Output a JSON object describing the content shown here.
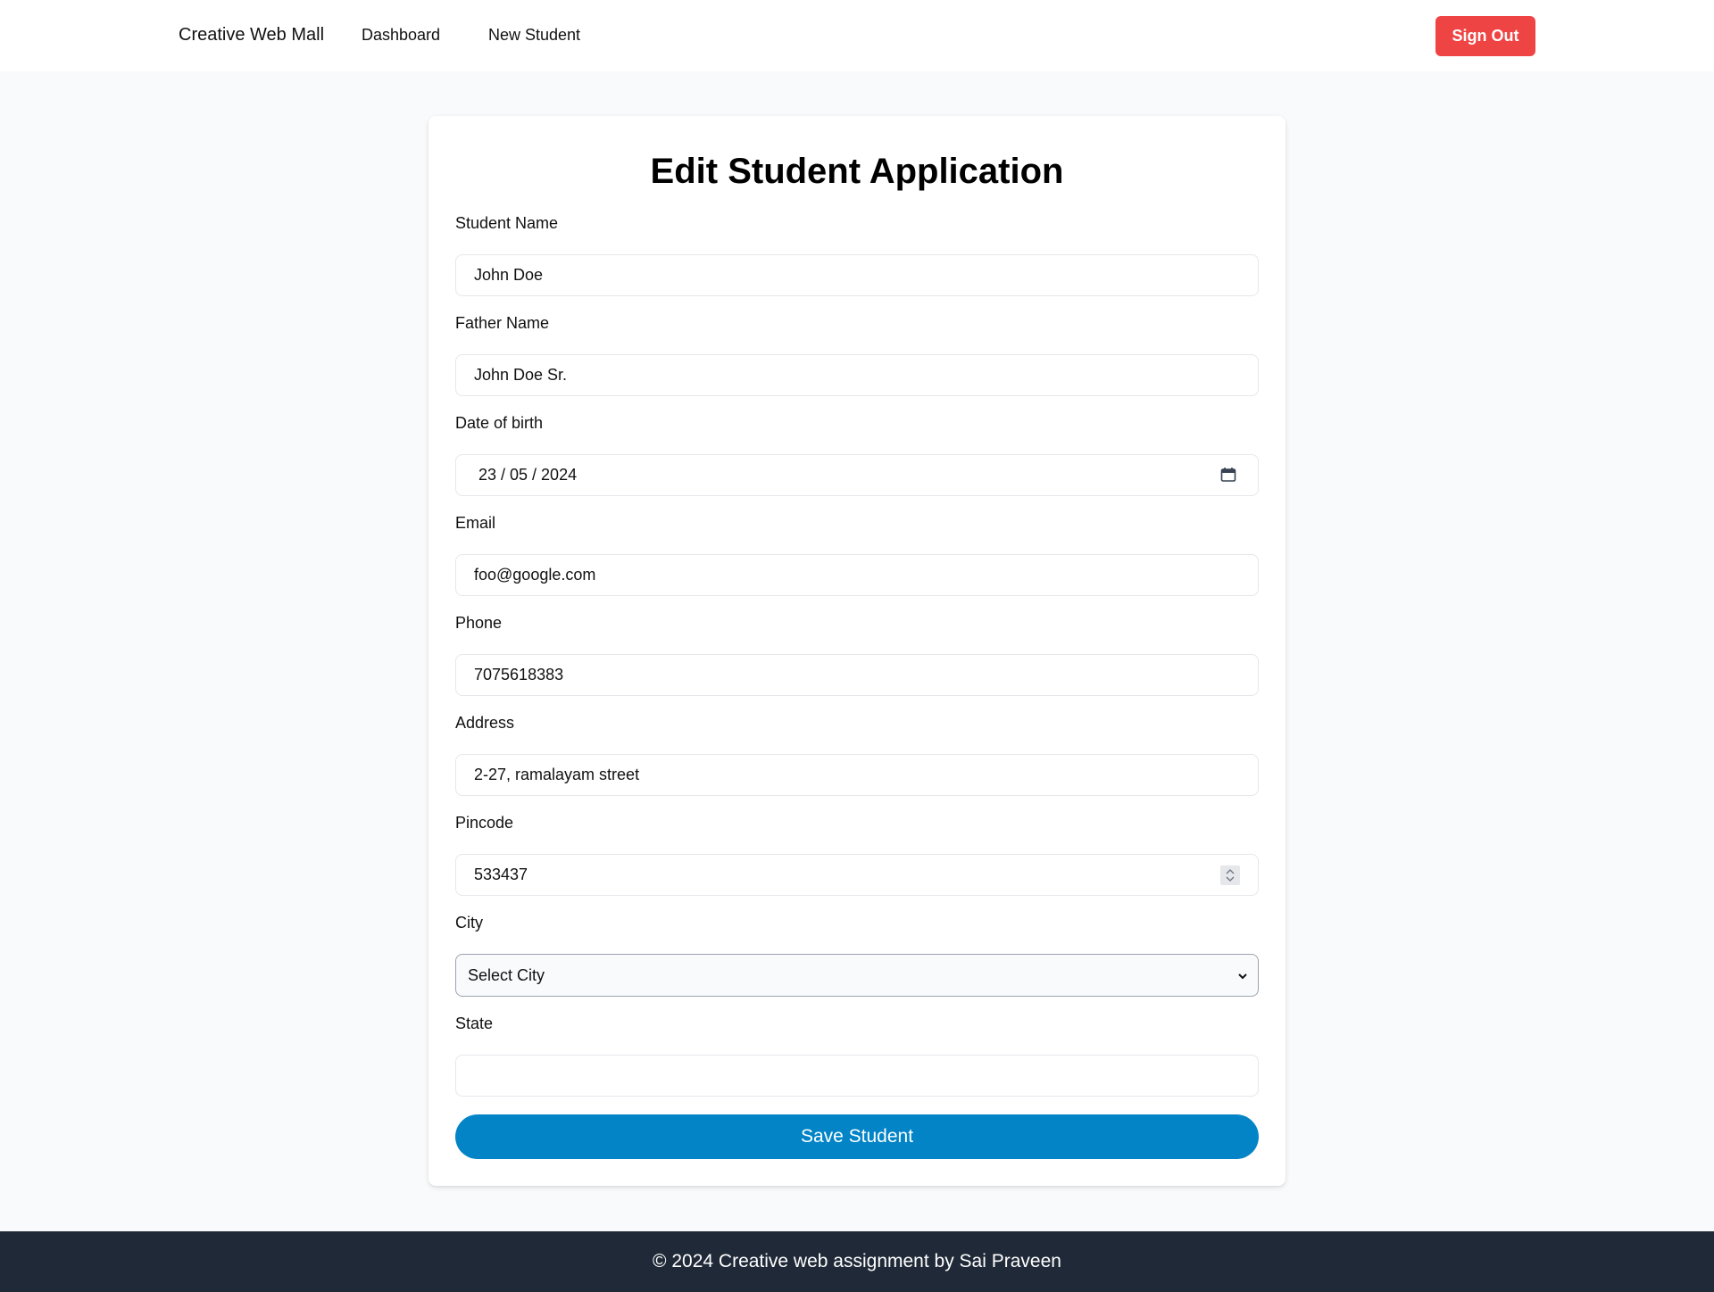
{
  "nav": {
    "brand": "Creative Web Mall",
    "links": [
      "Dashboard",
      "New Student"
    ],
    "signout_label": "Sign Out"
  },
  "form": {
    "title": "Edit Student Application",
    "fields": [
      {
        "label": "Student Name",
        "value": "John Doe"
      },
      {
        "label": "Father Name",
        "value": "John Doe Sr."
      },
      {
        "label": "Date of birth",
        "value": "23 / 05 / 2024"
      },
      {
        "label": "Email",
        "value": "foo@google.com"
      },
      {
        "label": "Phone",
        "value": "7075618383"
      },
      {
        "label": "Address",
        "value": "2-27, ramalayam street"
      },
      {
        "label": "Pincode",
        "value": "533437"
      },
      {
        "label": "City",
        "value": "Select City"
      },
      {
        "label": "State",
        "value": ""
      }
    ],
    "save_label": "Save Student"
  },
  "footer": {
    "text": "© 2024 Creative web assignment by Sai Praveen"
  },
  "colors": {
    "signout": "#ef4444",
    "save": "#0284c7",
    "footer_bg": "#1f2937"
  }
}
